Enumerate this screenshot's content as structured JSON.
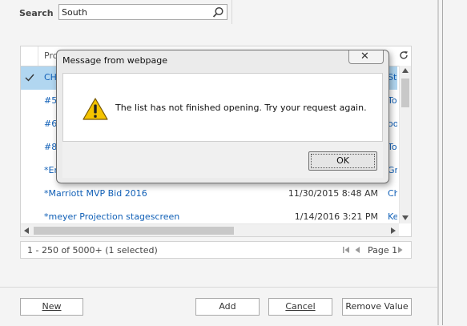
{
  "search": {
    "label": "Search",
    "value": "South"
  },
  "grid": {
    "header_col": "Pro",
    "rows": [
      {
        "name": "CH",
        "date": "",
        "owner": "St",
        "selected": true
      },
      {
        "name": "#5",
        "date": "",
        "owner": "To"
      },
      {
        "name": "#6",
        "date": "",
        "owner": "oo"
      },
      {
        "name": "#8",
        "date": "",
        "owner": "To"
      },
      {
        "name": "*En",
        "date": "",
        "owner": "Gr"
      },
      {
        "name": "*Marriott MVP Bid 2016",
        "date": "11/30/2015 8:48 AM",
        "owner": "Ch"
      },
      {
        "name": "*meyer Projection stagescreen",
        "date": "1/14/2016 3:21 PM",
        "owner": "Ke"
      }
    ]
  },
  "status": {
    "text": "1 - 250 of 5000+ (1 selected)",
    "page_label": "Page 1"
  },
  "buttons": {
    "new": "New",
    "add": "Add",
    "cancel": "Cancel",
    "remove_value": "Remove Value"
  },
  "dialog": {
    "title": "Message from webpage",
    "close_glyph": "✕",
    "message": "The list has not finished opening. Try your request again.",
    "ok": "OK"
  }
}
